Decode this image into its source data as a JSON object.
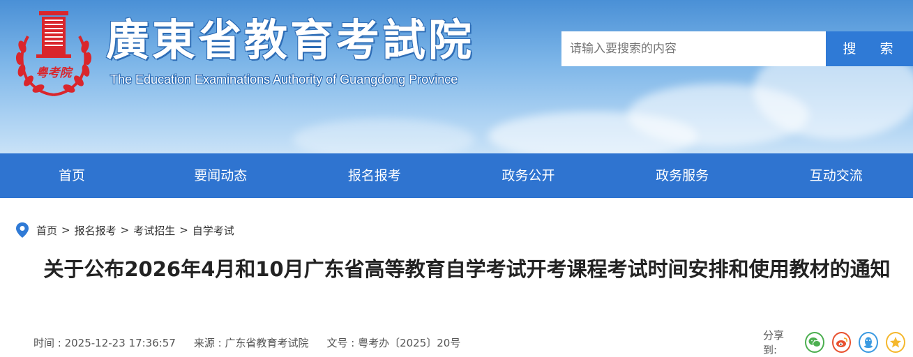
{
  "header": {
    "title": "廣東省教育考試院",
    "subtitle": "The Education Examinations Authority of Guangdong Province",
    "emblem_text": "粤考院"
  },
  "search": {
    "placeholder": "请输入要搜索的内容",
    "button_label": "搜 索"
  },
  "nav": {
    "items": [
      "首页",
      "要闻动态",
      "报名报考",
      "政务公开",
      "政务服务",
      "互动交流"
    ]
  },
  "breadcrumb": {
    "items": [
      "首页",
      "报名报考",
      "考试招生",
      "自学考试"
    ],
    "separator": ">"
  },
  "article": {
    "title": "关于公布2026年4月和10月广东省高等教育自学考试开考课程考试时间安排和使用教材的通知",
    "time": "时间 : 2025-12-23 17:36:57",
    "source": "来源 : 广东省教育考试院",
    "doc_no": "文号 : 粤考办〔2025〕20号"
  },
  "share": {
    "label": "分享到:",
    "icons": [
      "wechat-icon",
      "weibo-icon",
      "qq-icon",
      "qzone-icon"
    ]
  },
  "colors": {
    "nav_bg": "#2f74d0",
    "search_btn": "#2f7ad6",
    "emblem_red": "#d9262c"
  }
}
